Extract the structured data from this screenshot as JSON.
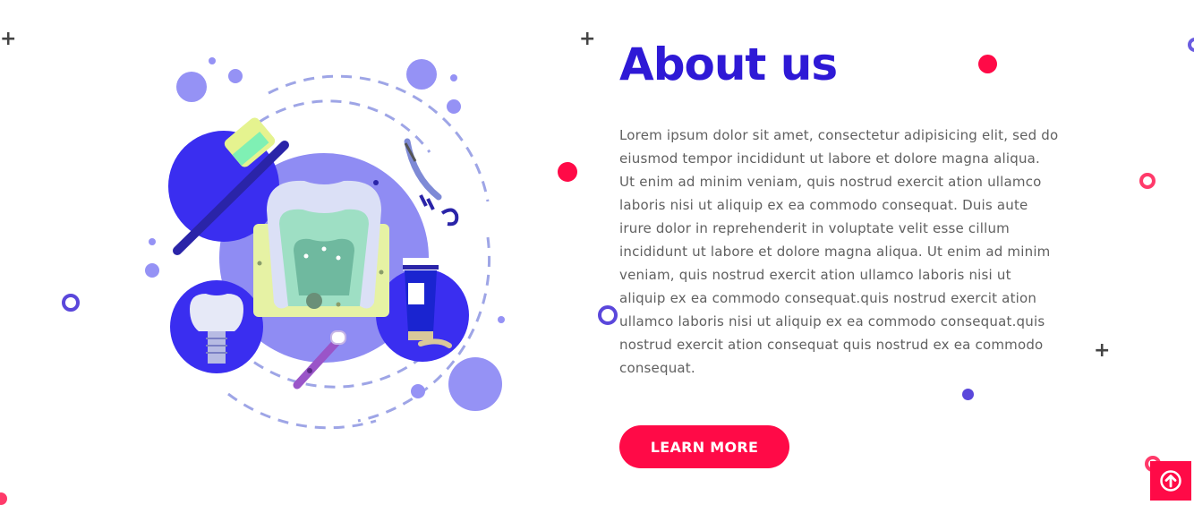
{
  "section": {
    "title": "About us",
    "body": "Lorem ipsum dolor sit amet, consectetur adipisicing elit, sed do eiusmod tempor incididunt ut labore et dolore magna aliqua. Ut enim ad minim veniam, quis nostrud exercit ation ullamco laboris nisi ut aliquip ex ea commodo consequat. Duis aute irure dolor in reprehenderit in voluptate velit esse cillum incididunt ut labore et dolore magna aliqua. Ut enim ad minim veniam, quis nostrud exercit ation ullamco laboris nisi ut aliquip ex ea commodo consequat.quis nostrud exercit ation ullamco laboris nisi ut aliquip ex ea commodo consequat.quis nostrud exercit ation  consequat quis nostrud  ex ea commodo consequat.",
    "button_label": "LEARN MORE"
  },
  "icons": {
    "illustration": "dental-care-illustration",
    "scroll_top": "arrow-up-circle-icon"
  },
  "colors": {
    "title": "#2e19d6",
    "accent": "#ff0a47",
    "body_text": "#606060",
    "illustration_blue": "#3a2ef0",
    "illustration_lavender": "#9592f5"
  }
}
